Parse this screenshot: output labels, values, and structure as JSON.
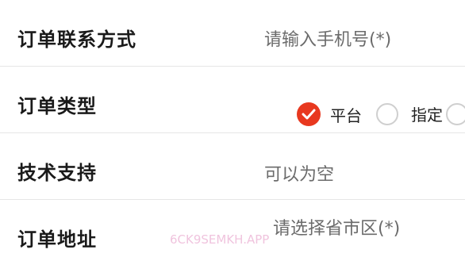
{
  "form": {
    "contact": {
      "label": "订单联系方式",
      "placeholder": "请输入手机号(*)"
    },
    "order_type": {
      "label": "订单类型",
      "options": [
        {
          "label": "平台",
          "selected": true
        },
        {
          "label": "指定",
          "selected": false
        }
      ]
    },
    "support": {
      "label": "技术支持",
      "placeholder": "可以为空"
    },
    "address": {
      "label": "订单地址",
      "placeholder": "请选择省市区(*)"
    }
  },
  "watermark": "6CK9SEMKH.APP",
  "colors": {
    "accent": "#e8381f",
    "placeholder": "#6b6b6b",
    "divider": "#e6e6e6"
  }
}
